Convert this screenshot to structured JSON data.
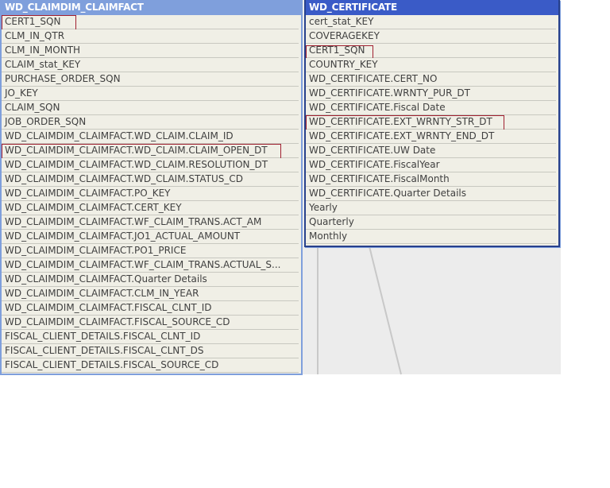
{
  "left_table": {
    "title": "WD_CLAIMDIM_CLAIMFACT",
    "fields": [
      "CERT1_SQN",
      "CLM_IN_QTR",
      "CLM_IN_MONTH",
      "CLAIM_stat_KEY",
      "PURCHASE_ORDER_SQN",
      "JO_KEY",
      "CLAIM_SQN",
      "JOB_ORDER_SQN",
      "WD_CLAIMDIM_CLAIMFACT.WD_CLAIM.CLAIM_ID",
      "WD_CLAIMDIM_CLAIMFACT.WD_CLAIM.CLAIM_OPEN_DT",
      "WD_CLAIMDIM_CLAIMFACT.WD_CLAIM.RESOLUTION_DT",
      "WD_CLAIMDIM_CLAIMFACT.WD_CLAIM.STATUS_CD",
      "WD_CLAIMDIM_CLAIMFACT.PO_KEY",
      "WD_CLAIMDIM_CLAIMFACT.CERT_KEY",
      "WD_CLAIMDIM_CLAIMFACT.WF_CLAIM_TRANS.ACT_AM",
      "WD_CLAIMDIM_CLAIMFACT.JO1_ACTUAL_AMOUNT",
      "WD_CLAIMDIM_CLAIMFACT.PO1_PRICE",
      "WD_CLAIMDIM_CLAIMFACT.WF_CLAIM_TRANS.ACTUAL_S...",
      "WD_CLAIMDIM_CLAIMFACT.Quarter Details",
      "WD_CLAIMDIM_CLAIMFACT.CLM_IN_YEAR",
      "WD_CLAIMDIM_CLAIMFACT.FISCAL_CLNT_ID",
      "WD_CLAIMDIM_CLAIMFACT.FISCAL_SOURCE_CD",
      "FISCAL_CLIENT_DETAILS.FISCAL_CLNT_ID",
      "FISCAL_CLIENT_DETAILS.FISCAL_CLNT_DS",
      "FISCAL_CLIENT_DETAILS.FISCAL_SOURCE_CD"
    ],
    "highlighted": [
      0,
      9
    ]
  },
  "right_table": {
    "title": "WD_CERTIFICATE",
    "fields": [
      "cert_stat_KEY",
      "COVERAGEKEY",
      "CERT1_SQN",
      "COUNTRY_KEY",
      "WD_CERTIFICATE.CERT_NO",
      "WD_CERTIFICATE.WRNTY_PUR_DT",
      "WD_CERTIFICATE.Fiscal Date",
      "WD_CERTIFICATE.EXT_WRNTY_STR_DT",
      "WD_CERTIFICATE.EXT_WRNTY_END_DT",
      "WD_CERTIFICATE.UW Date",
      "WD_CERTIFICATE.FiscalYear",
      "WD_CERTIFICATE.FiscalMonth",
      "WD_CERTIFICATE.Quarter Details",
      "Yearly",
      "Quarterly",
      "Monthly"
    ],
    "highlighted": [
      2,
      7
    ]
  },
  "colors": {
    "left_header": "#7f9fdc",
    "right_header": "#3a5bc7",
    "highlight": "#a02030"
  }
}
